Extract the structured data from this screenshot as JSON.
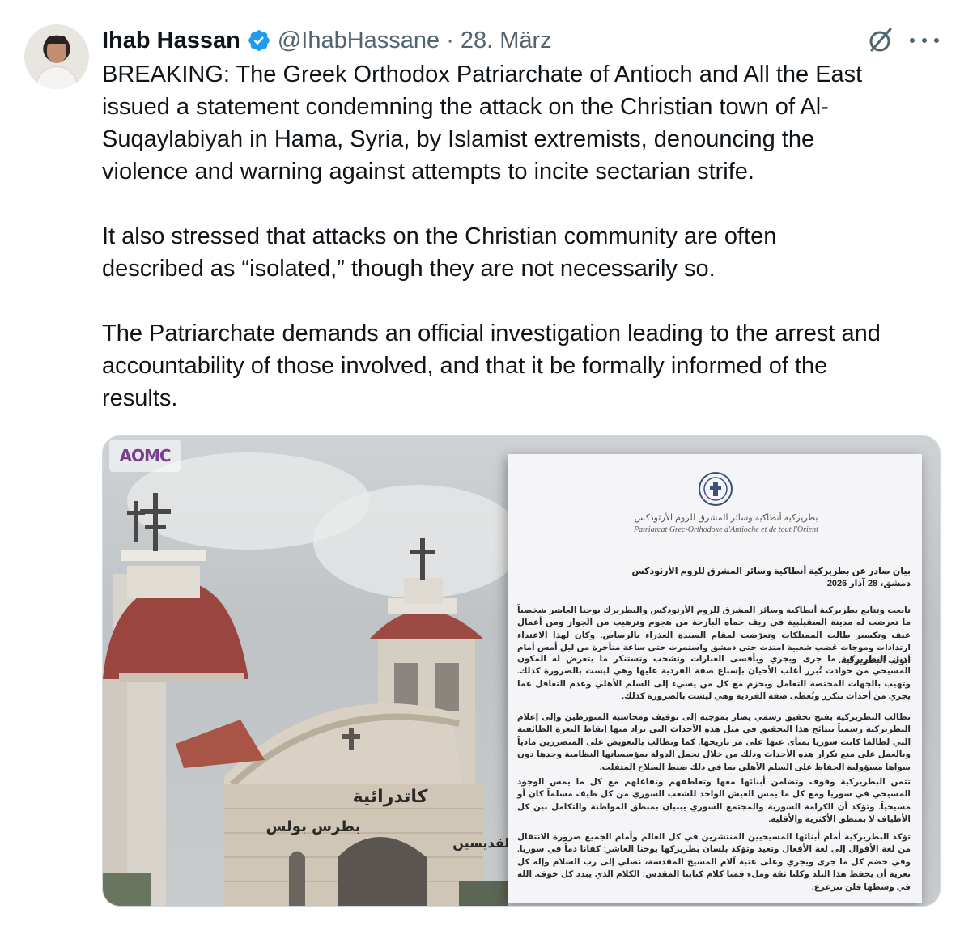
{
  "author": {
    "name": "Ihab Hassan",
    "handle": "@IhabHassane",
    "separator": "·",
    "date": "28. März",
    "verified": true,
    "avatar_icon": "profile-photo"
  },
  "actions": {
    "grok_icon": "grok-icon",
    "more_icon": "more-icon"
  },
  "tweet": {
    "paragraphs": [
      "BREAKING: The Greek Orthodox Patriarchate of Antioch and All the East\nissued a statement condemning the attack on the Christian town of Al-\nSuqaylabiyah in Hama, Syria, by Islamist extremists, denouncing the\nviolence and warning against attempts to incite sectarian strife.",
      "It also stressed that attacks on the Christian community are often\ndescribed as “isolated,” though they are not necessarily so.",
      "The Patriarchate demands an official investigation leading to the arrest and\naccountability of those involved, and that it be formally informed of the\nresults."
    ]
  },
  "media": {
    "logo_text": "AOMC",
    "church_sign_1": "كاتدرائية",
    "church_sign_2": "بطرس بولس",
    "church_sign_3": "القديسين",
    "document": {
      "header_ar": "بطريركية أنطاكية وسائر المشرق للروم الأرثوذكس",
      "header_fr": "Patriarcat Grec-Orthodoxe d'Antioche et de tout l'Orient",
      "title_line_1": "بيان صادر عن بطريركية أنطاكية وسائر المشرق للروم الأرثوذكس",
      "title_line_2": "دمشق، 28 آذار 2026",
      "para_1": "تابعت وتتابع بطريركية أنطاكية وسائر المشرق للروم الأرثوذكس والبطريرك يوحنا العاشر شخصياً ما تعرضت له مدينة السقيلبية في ريف حماه البارحة من هجوم وترهيب من الجوار ومن أعمال عنف وتكسير طالت الممتلكات وتعرّضت لمقام السيدة العذراء بالرصاص. وكان لهذا الاعتداء ارتدادات وموجات غضب شعبية امتدت حتى دمشق واستمرت حتى ساعة متأخرة من ليل أمس أمام أبواب البطريركية.",
      "para_2": "تدين البطريركية ما جرى ويجري وبأقسى العبارات وتشجب وتستنكر ما يتعرض له المكون المسيحي من حوادث تُبرر أغلب الأحيان بإسباغ صفة الفردية عليها وهي ليست بالضرورة كذلك. وتهيب بالجهات المختصة التعامل وبحزم مع كل من يسيء إلى السلم الأهلي وعدم التغافل عما يجري من أحداث تتكرر وتُعطى صفة الفردية وهي ليست بالضرورة كذلك.",
      "para_3": "تطالب البطريركية بفتح تحقيق رسمي يصار بموجبه إلى توقيف ومحاسبة المتورطين وإلى إعلام البطريركية رسمياً بنتائج هذا التحقيق في مثل هذه الأحداث التي يراد منها إيقاظ النعرة الطائفية التي لطالما كانت سوريا بمنأى عنها على مر تاريخها. كما وتطالب بالتعويض على المتضررين مادياً وبالعمل على منع تكرار هذه الأحداث وذلك من خلال تحمل الدولة بمؤسساتها النظامية وحدها دون سواها مسؤولية الحفاظ على السلم الأهلي بما في ذلك ضبط السلاح المتفلت.",
      "para_4": "تثمن البطريركية وقوف وتضامن أبنائها معها وتعاطفهم وتفاعلهم مع كل ما يمس الوجود المسيحي في سوريا ومع كل ما يمس العيش الواحد للشعب السوري من كل طيف مسلماً كان أو مسيحياً. وتؤكد أن الكرامة السورية والمجتمع السوري يبنيان بمنطق المواطنة والتكامل بين كل الأطياف لا بمنطق الأكثرية والأقلية.",
      "para_5": "تؤكد البطريركية أمام أبنائها المسيحيين المنتشرين في كل العالم وأمام الجميع ضرورة الانتقال من لغة الأقوال إلى لغة الأفعال وتعيد وتؤكد بلسان بطريركها يوحنا العاشر: كفانا دماً في سوريا. وفي خضم كل ما جرى ويجري وعلى عتبة آلام المسيح المقدسة، نصلي إلى رب السلام وإله كل تعزية أن يحفظ هذا البلد وكلنا ثقة وملء فمنا كلام كتابنا المقدس: الكلام الذي يبدد كل خوف. الله في وسطها فلن تتزعزع."
    }
  },
  "colors": {
    "text": "#0f1419",
    "muted": "#536471",
    "verified": "#1d9bf0",
    "border": "#cfd9de"
  }
}
